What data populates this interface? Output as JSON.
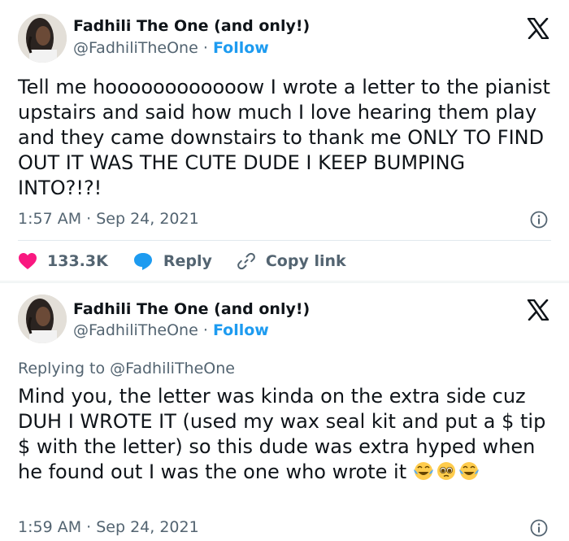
{
  "tweets": [
    {
      "author": {
        "name": "Fadhili The One (and only!)",
        "handle": "@FadhiliTheOne",
        "separator": "·",
        "follow_label": "Follow"
      },
      "text": "Tell me hoooooooooooow I wrote a letter to the pianist upstairs and said how much I love hearing them play and they came downstairs to thank me ONLY TO FIND OUT IT WAS THE CUTE DUDE I KEEP BUMPING INTO?!?!",
      "timestamp": "1:57 AM · Sep 24, 2021",
      "actions": {
        "likes": "133.3K",
        "reply_label": "Reply",
        "copy_label": "Copy link"
      }
    },
    {
      "author": {
        "name": "Fadhili The One (and only!)",
        "handle": "@FadhiliTheOne",
        "separator": "·",
        "follow_label": "Follow"
      },
      "replying_prefix": "Replying to",
      "replying_to": "@FadhiliTheOne",
      "text": "Mind you, the letter was kinda on the extra side cuz DUH I WROTE IT (used my wax seal kit and put a $ tip $ with the letter) so this dude was extra hyped when he found out I was the one who wrote it",
      "emojis": [
        "face-with-tears-of-joy",
        "pleading-face",
        "face-with-tears-of-joy"
      ],
      "timestamp": "1:59 AM · Sep 24, 2021"
    }
  ],
  "colors": {
    "text": "#0f1419",
    "secondary": "#536471",
    "accent": "#1d9bf0",
    "like": "#f91880"
  },
  "icons": [
    "x-logo-icon",
    "info-icon",
    "heart-icon",
    "reply-bubble-icon",
    "link-icon"
  ]
}
